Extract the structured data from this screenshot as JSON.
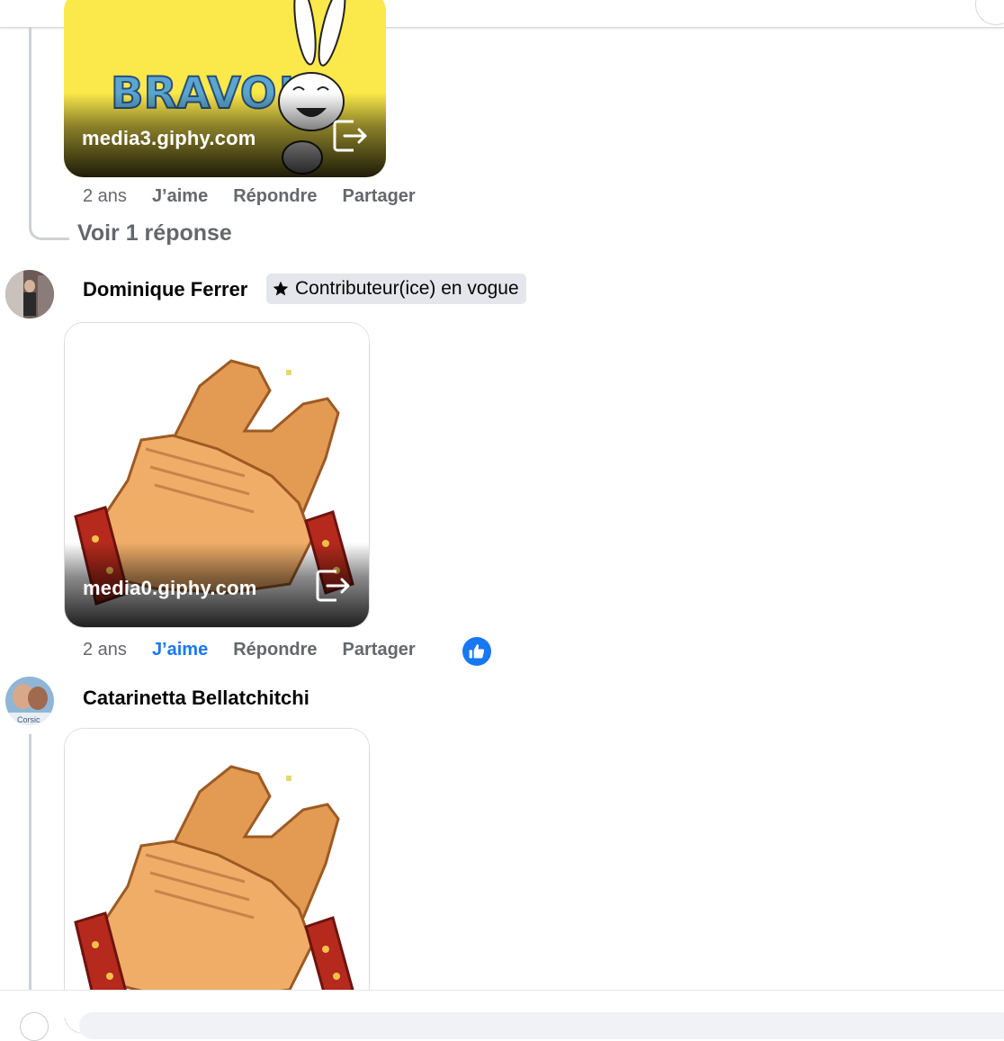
{
  "comments": [
    {
      "gif": {
        "domain": "media3.giphy.com",
        "alt": "BRAVO!"
      },
      "actions": {
        "time": "2 ans",
        "like": "J’aime",
        "reply": "Répondre",
        "share": "Partager"
      },
      "view_replies": "Voir 1 réponse"
    },
    {
      "author": "Dominique Ferrer",
      "badge": "Contributeur(ice) en vogue",
      "gif": {
        "domain": "media0.giphy.com"
      },
      "actions": {
        "time": "2 ans",
        "like": "J’aime",
        "reply": "Répondre",
        "share": "Partager",
        "liked": true
      }
    },
    {
      "author": "Catarinetta Bellatchitchi",
      "avatar_text": "Corsic"
    }
  ],
  "colors": {
    "link_blue": "#1877f2",
    "muted": "#65676b",
    "badge_bg": "#e4e6eb"
  }
}
